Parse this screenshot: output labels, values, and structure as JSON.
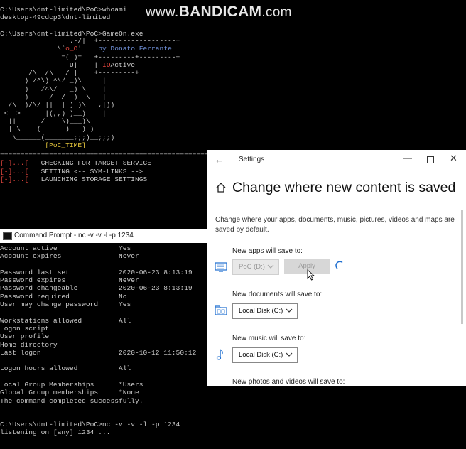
{
  "watermark": {
    "prefix": "www.",
    "brand": "BANDICAM",
    "suffix": ".com"
  },
  "terminal": {
    "top_lines": "C:\\Users\\dnt-limited\\PoC>whoami\ndesktop-49cdcp3\\dnt-limited\n\nC:\\Users\\dnt-limited\\PoC>GameOn.exe",
    "ascii_pre": "               __.-/|  +-------------------+\n              \\`",
    "ascii_red1": "o_O",
    "ascii_mid1": "'  | ",
    "ascii_blue": "by Donato Ferrante",
    "ascii_mid2": " |\n               =( )=   +---------+---------+\n                 U|    | ",
    "ascii_red2": "IO",
    "ascii_mid3": "Active |\n       /\\  /\\   / |    +---------+\n      ) /^\\) ^\\/ _)\\     |\n      )   /^\\/   _) \\    |\n      )   _ /  / _)  \\___|_\n  /\\  )/\\/ ||  | )_)\\___,|))\n <  >      |(,,) )__)    |\n  ||      /    \\)___)\\\n  | \\____(      )___) )____\n   \\______(_______;;;)__;;;)\n           ",
    "ascii_yellow": "[PoC_TIME]",
    "separator": "======================================================",
    "steps": [
      {
        "mark": "[-]...[",
        "text": "   CHECKING FOR TARGET SERVICE"
      },
      {
        "mark": "[-]...[",
        "text": "   SETTING <-- SYM-LINKS -->"
      },
      {
        "mark": "[-]...[",
        "text": "   LAUNCHING STORAGE SETTINGS"
      }
    ]
  },
  "cmd_window": {
    "title": "Command Prompt - nc  -v -v -l -p 1234",
    "net_user": "Account active               Yes\nAccount expires              Never\n\nPassword last set            ‎2020-‎06-‎23 8:13:19 \nPassword expires             Never\nPassword changeable          ‎2020-‎06-‎23 8:13:19 \nPassword required            No\nUser may change password     Yes\n\nWorkstations allowed         All\nLogon script\nUser profile\nHome directory\nLast logon                   ‎2020-‎10-‎12 11:50:12\n\nLogon hours allowed          All\n\nLocal Group Memberships      *Users\nGlobal Group memberships     *None\nThe command completed successfully.",
    "nc_lines": "C:\\Users\\dnt-limited\\PoC>nc -v -v -l -p 1234\nlistening on [any] 1234 ..."
  },
  "settings": {
    "window_title": "Settings",
    "page_title": "Change where new content is saved",
    "description": "Change where your apps, documents, music, pictures, videos and maps are saved by default.",
    "sections": [
      {
        "label": "New apps will save to:",
        "value": "PoC (D:)",
        "button": "Apply"
      },
      {
        "label": "New documents will save to:",
        "value": "Local Disk (C:)"
      },
      {
        "label": "New music will save to:",
        "value": "Local Disk (C:)"
      },
      {
        "label": "New photos and videos will save to:"
      }
    ]
  },
  "colors": {
    "accent_blue": "#1f6fd0",
    "terminal_red": "#e0453d",
    "terminal_yellow": "#e2c33c",
    "terminal_blue": "#6f8fd6"
  }
}
